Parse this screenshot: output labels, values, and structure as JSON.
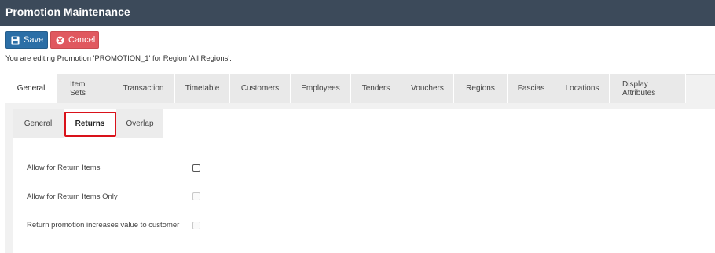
{
  "window": {
    "title": "Promotion Maintenance"
  },
  "toolbar": {
    "save_label": "Save",
    "cancel_label": "Cancel",
    "save_icon": "floppy-disk-icon",
    "cancel_icon": "x-circle-icon"
  },
  "editing_message": "You are editing Promotion 'PROMOTION_1' for Region 'All Regions'.",
  "tabs": [
    {
      "label": "General",
      "active": true
    },
    {
      "label": "Item Sets",
      "active": false
    },
    {
      "label": "Transaction",
      "active": false
    },
    {
      "label": "Timetable",
      "active": false
    },
    {
      "label": "Customers",
      "active": false
    },
    {
      "label": "Employees",
      "active": false
    },
    {
      "label": "Tenders",
      "active": false
    },
    {
      "label": "Vouchers",
      "active": false
    },
    {
      "label": "Regions",
      "active": false
    },
    {
      "label": "Fascias",
      "active": false
    },
    {
      "label": "Locations",
      "active": false
    },
    {
      "label": "Display Attributes",
      "active": false
    }
  ],
  "subtabs": [
    {
      "label": "General",
      "active": false
    },
    {
      "label": "Returns",
      "active": true
    },
    {
      "label": "Overlap",
      "active": false
    }
  ],
  "returns": {
    "allow_return_items": {
      "label": "Allow for Return Items",
      "checked": false,
      "enabled": true
    },
    "allow_return_items_only": {
      "label": "Allow for Return Items Only",
      "checked": false,
      "enabled": false
    },
    "return_increases_value": {
      "label": "Return promotion increases value to customer",
      "checked": false,
      "enabled": false
    }
  },
  "colors": {
    "titlebar": "#3c4a5a",
    "save_button": "#2b6ea6",
    "cancel_button": "#e0585f",
    "highlight": "#d9121a"
  }
}
